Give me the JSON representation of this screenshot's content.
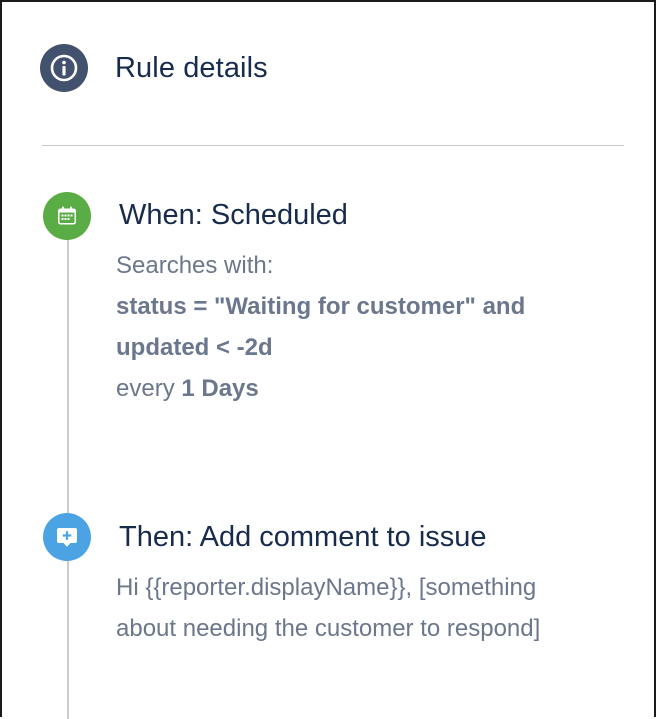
{
  "rule_details": {
    "label": "Rule details",
    "icon": "info-icon",
    "icon_color": "#42526e"
  },
  "trigger": {
    "title": "When: Scheduled",
    "icon": "calendar-icon",
    "icon_color": "#5aac44",
    "searches_label": "Searches with:",
    "jql_line1": "status = \"Waiting for customer\" and",
    "jql_line2": "updated < -2d",
    "every_label": "every",
    "interval": "1 Days"
  },
  "action": {
    "title": "Then: Add comment to issue",
    "icon": "add-comment-icon",
    "icon_color": "#4ba3e3",
    "comment_line1": "Hi {{reporter.displayName}}, [something",
    "comment_line2": "about needing the customer to respond]"
  }
}
